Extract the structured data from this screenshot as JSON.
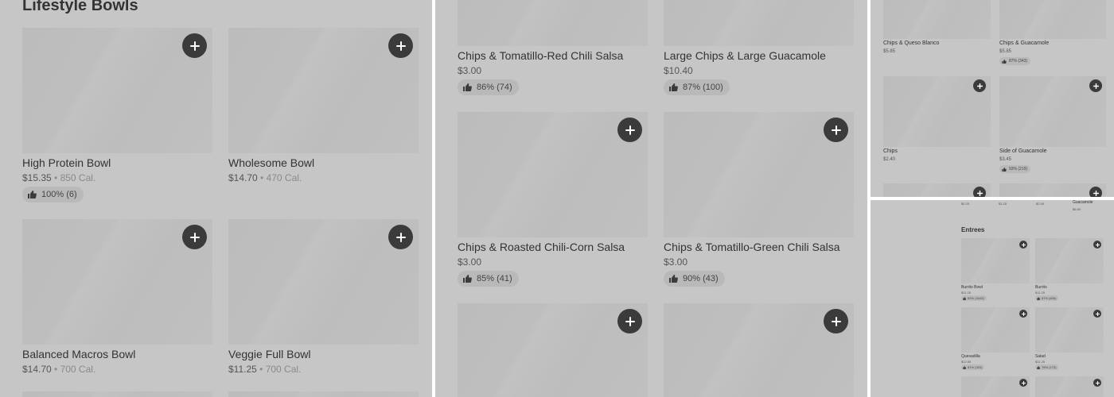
{
  "panel1": {
    "section_title": "Lifestyle Bowls",
    "items": [
      {
        "name": "High Protein Bowl",
        "price": "$15.35",
        "calories": "850 Cal.",
        "rating": "100% (6)"
      },
      {
        "name": "Wholesome Bowl",
        "price": "$14.70",
        "calories": "470 Cal."
      },
      {
        "name": "Balanced Macros Bowl",
        "price": "$14.70",
        "calories": "700 Cal."
      },
      {
        "name": "Veggie Full Bowl",
        "price": "$11.25",
        "calories": "700 Cal."
      }
    ]
  },
  "panel2": {
    "items": [
      {
        "name": "Chips & Tomatillo-Red Chili Salsa",
        "price": "$3.00",
        "rating": "86% (74)"
      },
      {
        "name": "Large Chips & Large Guacamole",
        "price": "$10.40",
        "rating": "87% (100)"
      },
      {
        "name": "Chips & Roasted Chili-Corn Salsa",
        "price": "$3.00",
        "rating": "85% (41)"
      },
      {
        "name": "Chips & Tomatillo-Green Chili Salsa",
        "price": "$3.00",
        "rating": "90% (43)"
      }
    ]
  },
  "panel3": {
    "items": [
      {
        "name": "Chips & Queso Blanco",
        "price": "$5.85"
      },
      {
        "name": "Chips & Guacamole",
        "price": "$5.85",
        "rating": "87% (343)"
      },
      {
        "name": "Chips",
        "price": "$2.40"
      },
      {
        "name": "Side of Guacamole",
        "price": "$3.45",
        "rating": "93% (219)"
      }
    ]
  },
  "panel4": {
    "top_prices": [
      "$0.25",
      "$1.25",
      "$2.95",
      "$5.85"
    ],
    "top_name": "Guacamole",
    "section_title": "Entrees",
    "items": [
      {
        "name": "Burrito Bowl",
        "price": "$11.25",
        "rating": "83% (3443)"
      },
      {
        "name": "Burrito",
        "price": "$11.25",
        "rating": "87% (606)"
      },
      {
        "name": "Quesadilla",
        "price": "$12.85",
        "rating": "81% (320)"
      },
      {
        "name": "Salad",
        "price": "$11.25",
        "rating": "78% (170)"
      }
    ]
  },
  "labels": {
    "separator": " • "
  },
  "icons": {
    "add": "plus-icon",
    "rating": "thumbs-up-icon"
  }
}
